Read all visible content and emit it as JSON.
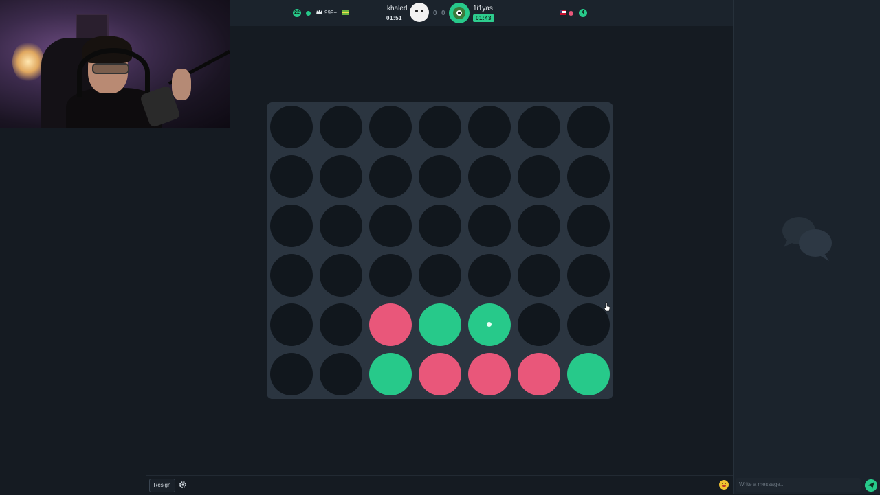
{
  "header": {
    "left_player": {
      "badge_count": "22",
      "rating": "999+",
      "name": "khaled",
      "timer": "01:51",
      "score": "0"
    },
    "right_player": {
      "name": "1i1yas",
      "timer": "01:43",
      "score": "0",
      "badge_count": "4"
    }
  },
  "board": {
    "rows": 6,
    "cols": 7,
    "cells": [
      [
        "empty",
        "empty",
        "empty",
        "empty",
        "empty",
        "empty",
        "empty"
      ],
      [
        "empty",
        "empty",
        "empty",
        "empty",
        "empty",
        "empty",
        "empty"
      ],
      [
        "empty",
        "empty",
        "empty",
        "empty",
        "empty",
        "empty",
        "empty"
      ],
      [
        "empty",
        "empty",
        "empty",
        "empty",
        "empty",
        "empty",
        "empty"
      ],
      [
        "empty",
        "empty",
        "red",
        "green",
        "green",
        "empty",
        "empty"
      ],
      [
        "empty",
        "empty",
        "green",
        "red",
        "red",
        "red",
        "green"
      ]
    ],
    "last_move": {
      "row": 4,
      "col": 4
    },
    "colors": {
      "red": "#e9577a",
      "green": "#27c98a",
      "empty": "#11171d",
      "board": "#2b3540"
    }
  },
  "controls": {
    "resign_label": "Resign",
    "settings_icon": "gear-icon"
  },
  "chat": {
    "placeholder": "Write a message...",
    "empty_icon": "chat-bubbles-icon",
    "send_icon": "send-icon",
    "emoji_icon": "emoji-icon"
  }
}
